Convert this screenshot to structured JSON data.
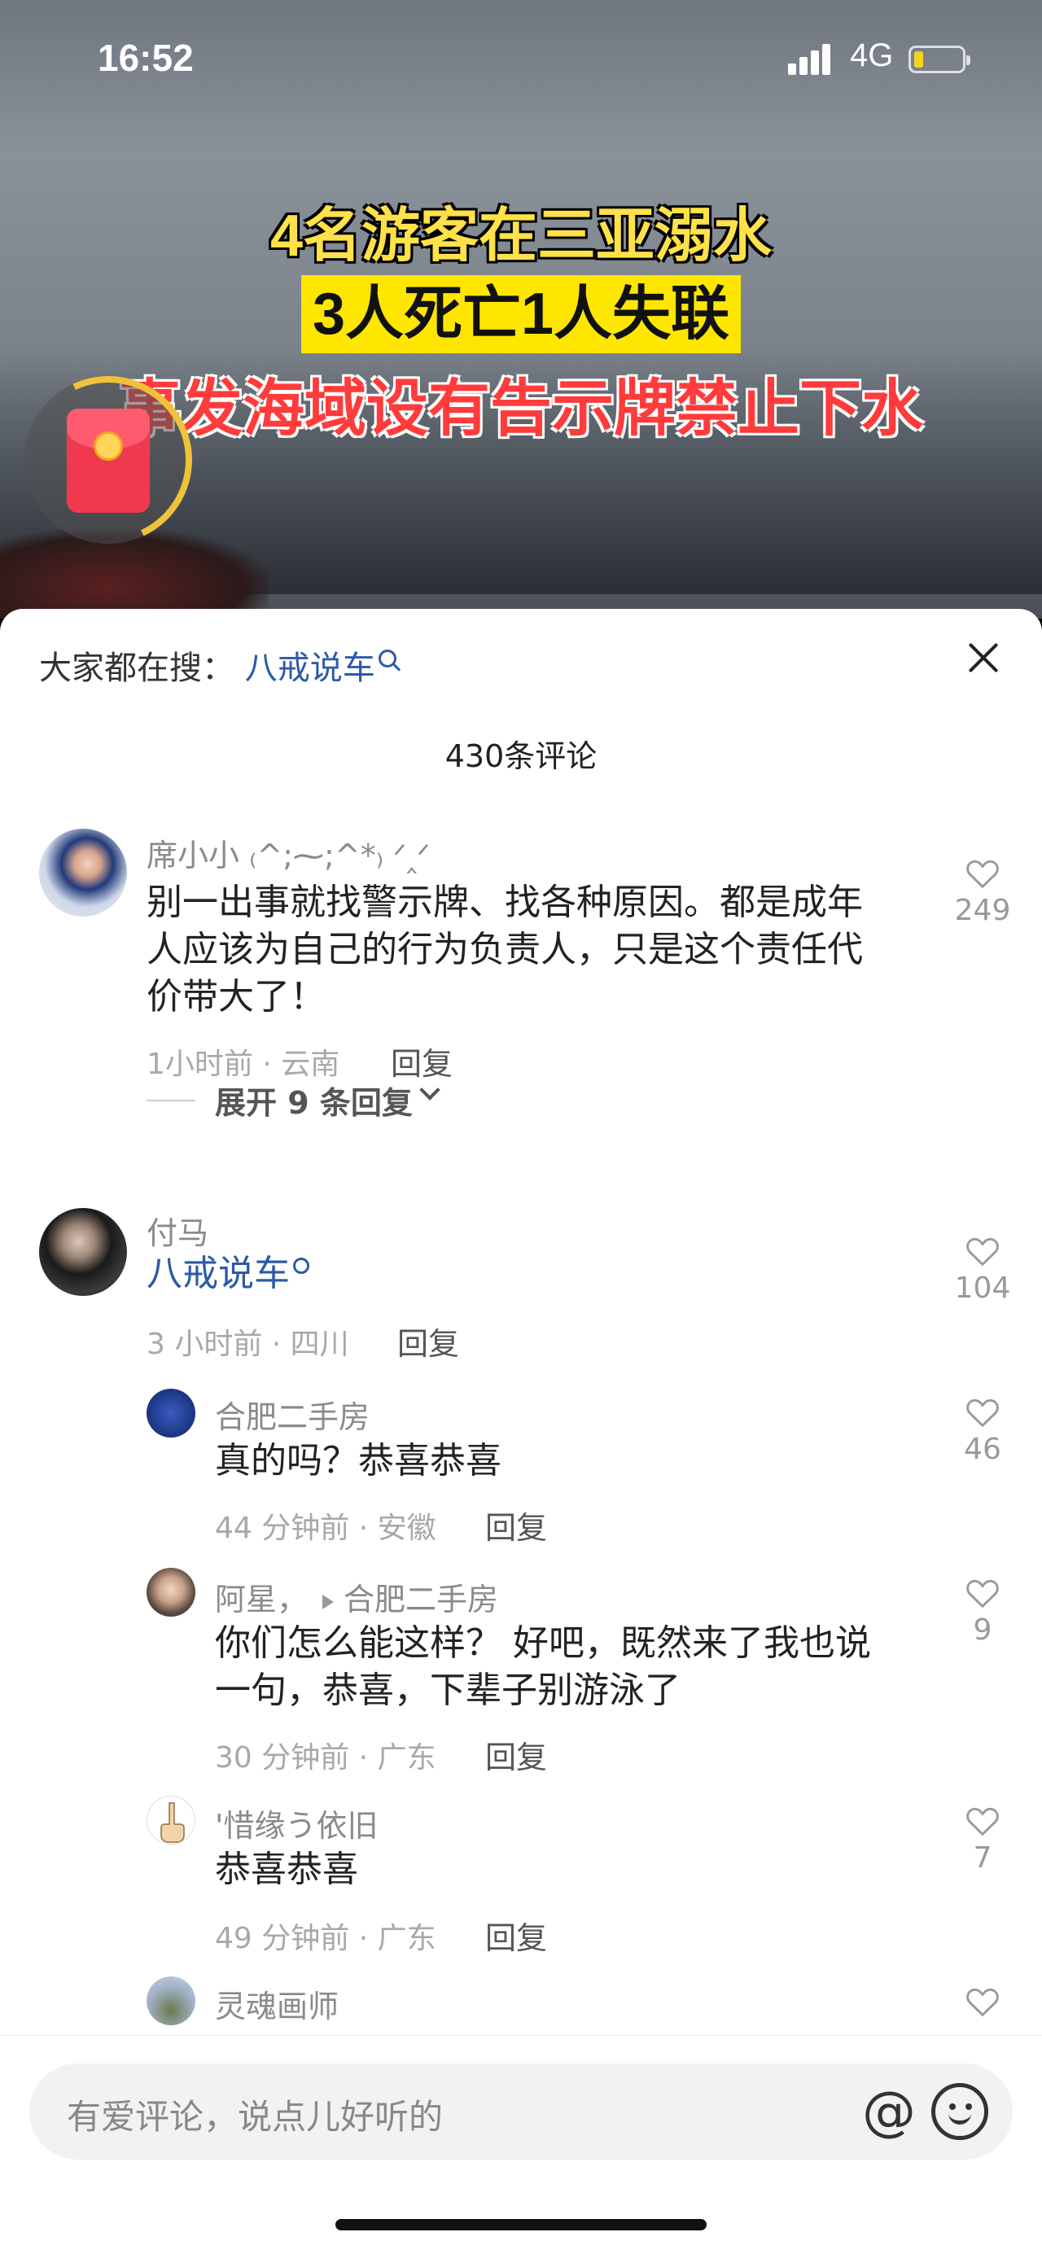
{
  "status_bar": {
    "time": "16:52",
    "network": "4G"
  },
  "video": {
    "headline_line1": "4名游客在三亚溺水",
    "headline_line2": "3人死亡1人失联",
    "headline_line3": "事发海域设有告示牌禁止下水"
  },
  "search": {
    "prefix": "大家都在搜：",
    "keyword": "八戒说车"
  },
  "comment_count": "430条评论",
  "comments": [
    {
      "name": "席小小 ₍^;⁓;^*₎ ᐟ‸ᐟ",
      "lines": [
        "别一出事就找警示牌、找各种原因。都是成年",
        "人应该为自己的行为负责人，只是这个责任代",
        "价带大了！"
      ],
      "meta": "1小时前 · 云南",
      "reply": "回复",
      "likes": "249"
    },
    {
      "name": "付马",
      "lines": [
        "八戒说车"
      ],
      "meta": "3 小时前 · 四川",
      "reply": "回复",
      "likes": "104"
    }
  ],
  "expand_label": "展开 9 条回复",
  "replies": [
    {
      "name": "合肥二手房",
      "lines": [
        "真的吗？恭喜恭喜"
      ],
      "meta": "44 分钟前 · 安徽",
      "reply": "回复",
      "likes": "46"
    },
    {
      "name": "阿星，",
      "reply_to": "合肥二手房",
      "lines": [
        "你们怎么能这样？  好吧，既然来了我也说",
        "一句，恭喜，下辈子别游泳了"
      ],
      "meta": "30 分钟前 · 广东",
      "reply": "回复",
      "likes": "9"
    },
    {
      "name": "'惜缘う依旧",
      "lines": [
        "恭喜恭喜"
      ],
      "meta": "49 分钟前 · 广东",
      "reply": "回复",
      "likes": "7"
    },
    {
      "name": "灵魂画师",
      "lines": [],
      "likes": ""
    }
  ],
  "input": {
    "placeholder": "有爱评论，说点儿好听的"
  },
  "icons": {
    "mention": "at-icon",
    "emoji": "emoji-icon",
    "close": "close-icon",
    "like": "heart-icon"
  }
}
